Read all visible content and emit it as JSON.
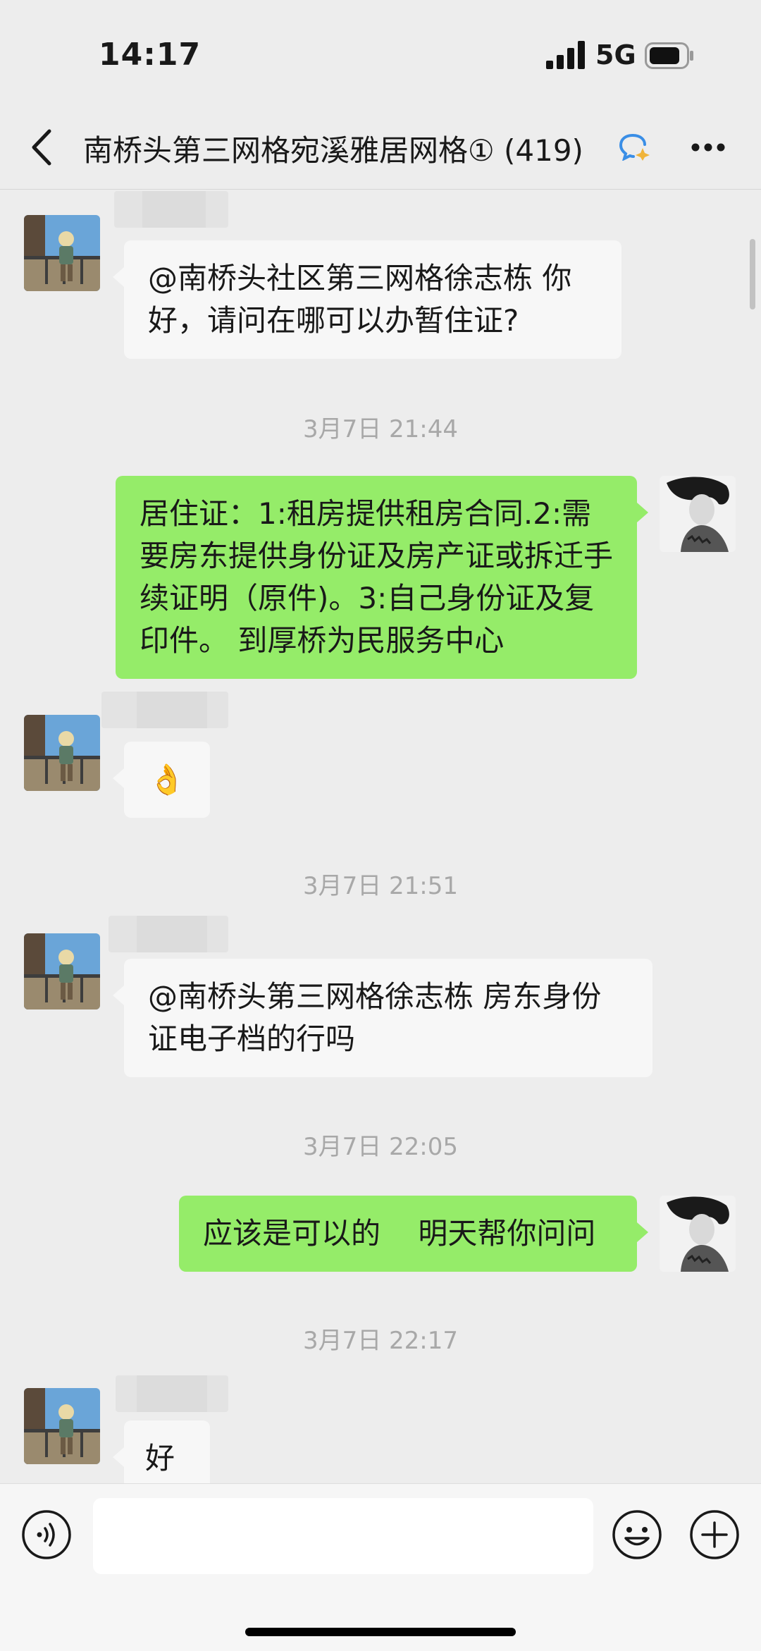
{
  "status_bar": {
    "time": "14:17",
    "network": "5G"
  },
  "header": {
    "title": "南桥头第三网格宛溪雅居网格① (419)",
    "back_icon": "chevron-left-icon",
    "more_icon": "more-dots-icon"
  },
  "colors": {
    "background": "#ededed",
    "incoming_bubble": "#f7f7f7",
    "outgoing_bubble": "#95ec69",
    "timestamp": "#a8a8a8"
  },
  "messages": [
    {
      "type": "incoming",
      "text": "@南桥头社区第三网格徐志栋 你好，请问在哪可以办暂住证?"
    },
    {
      "type": "timestamp",
      "text": "3月7日 21:44"
    },
    {
      "type": "outgoing",
      "text": "居住证：1:租房提供租房合同.2:需要房东提供身份证及房产证或拆迁手续证明（原件)。3:自己身份证及复印件。 到厚桥为民服务中心"
    },
    {
      "type": "incoming",
      "text": "👌"
    },
    {
      "type": "timestamp",
      "text": "3月7日 21:51"
    },
    {
      "type": "incoming",
      "text": "@南桥头第三网格徐志栋 房东身份证电子档的行吗"
    },
    {
      "type": "timestamp",
      "text": "3月7日 22:05"
    },
    {
      "type": "outgoing",
      "text": "应该是可以的    明天帮你问问"
    },
    {
      "type": "timestamp",
      "text": "3月7日 22:17"
    },
    {
      "type": "incoming",
      "text": "好"
    }
  ],
  "input_bar": {
    "voice_icon": "voice-icon",
    "emoji_icon": "emoji-icon",
    "plus_icon": "plus-circle-icon",
    "input_value": ""
  }
}
